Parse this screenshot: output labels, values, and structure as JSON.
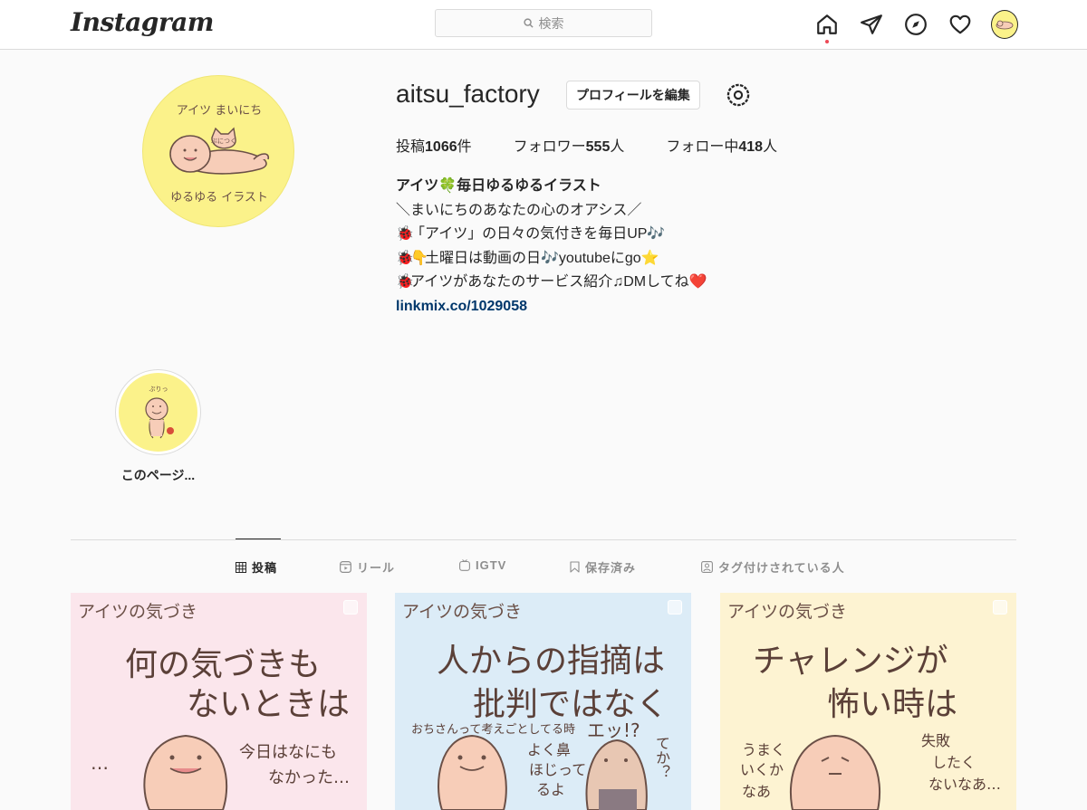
{
  "nav": {
    "logo": "Instagram",
    "search_placeholder": "検索"
  },
  "profile": {
    "username": "aitsu_factory",
    "edit_button": "プロフィールを編集",
    "stats": {
      "posts_label": "投稿",
      "posts_count": "1066",
      "posts_unit": "件",
      "followers_label": "フォロワー",
      "followers_count": "555",
      "followers_unit": "人",
      "following_label": "フォロー中",
      "following_count": "418",
      "following_unit": "人"
    },
    "bio": {
      "name_prefix": "アイツ",
      "name_emoji": "🍀",
      "name_suffix": "毎日ゆるゆるイラスト",
      "line1": "＼まいにちのあなたの心のオアシス／",
      "line2_emoji": "🐞",
      "line2": "「アイツ」の日々の気付きを毎日UP🎶",
      "line3_emoji1": "🐞",
      "line3_emoji2": "👇",
      "line3": "土曜日は動画の日🎶youtubeにgo⭐",
      "line4_emoji": "🐞",
      "line4": "アイツがあなたのサービス紹介♫DMしてね❤️",
      "link": "linkmix.co/1029058"
    },
    "avatar_text_top": "アイツ まいにち",
    "avatar_text_bottom": "ゆるゆる イラスト",
    "avatar_text_cat": "ぶにつく"
  },
  "highlight": {
    "label": "このページ...",
    "image_text": "ぷりっ"
  },
  "tabs": [
    {
      "label": "投稿",
      "icon": "grid-icon"
    },
    {
      "label": "リール",
      "icon": "reels-icon"
    },
    {
      "label": "IGTV",
      "icon": "igtv-icon"
    },
    {
      "label": "保存済み",
      "icon": "bookmark-icon"
    },
    {
      "label": "タグ付けされている人",
      "icon": "tagged-icon"
    }
  ],
  "posts": [
    {
      "header": "アイツの気づき",
      "line1": "何の気づきも",
      "line2": "ないときは",
      "side1": "今日はなにも",
      "side2": "なかった…",
      "dots": "…",
      "bg": "#fbe6ec"
    },
    {
      "header": "アイツの気づき",
      "line1": "人からの指摘は",
      "line2": "批判ではなく",
      "side1": "おちさんって考えごとしてる時",
      "side2": "よく鼻",
      "side3": "ほじって",
      "side4": "るよ",
      "exclaim": "エッ!?",
      "side5": "てか？",
      "bg": "#dcecf7"
    },
    {
      "header": "アイツの気づき",
      "line1": "チャレンジが",
      "line2": "怖い時は",
      "side1": "うまく",
      "side2": "いくか",
      "side3": "なあ",
      "side4": "失敗",
      "side5": "したく",
      "side6": "ないなあ…",
      "bg": "#fdf3d2"
    }
  ],
  "colors": {
    "link": "#00376b",
    "notification_dot": "#ed4956",
    "avatar_bg": "#fbf28a"
  }
}
